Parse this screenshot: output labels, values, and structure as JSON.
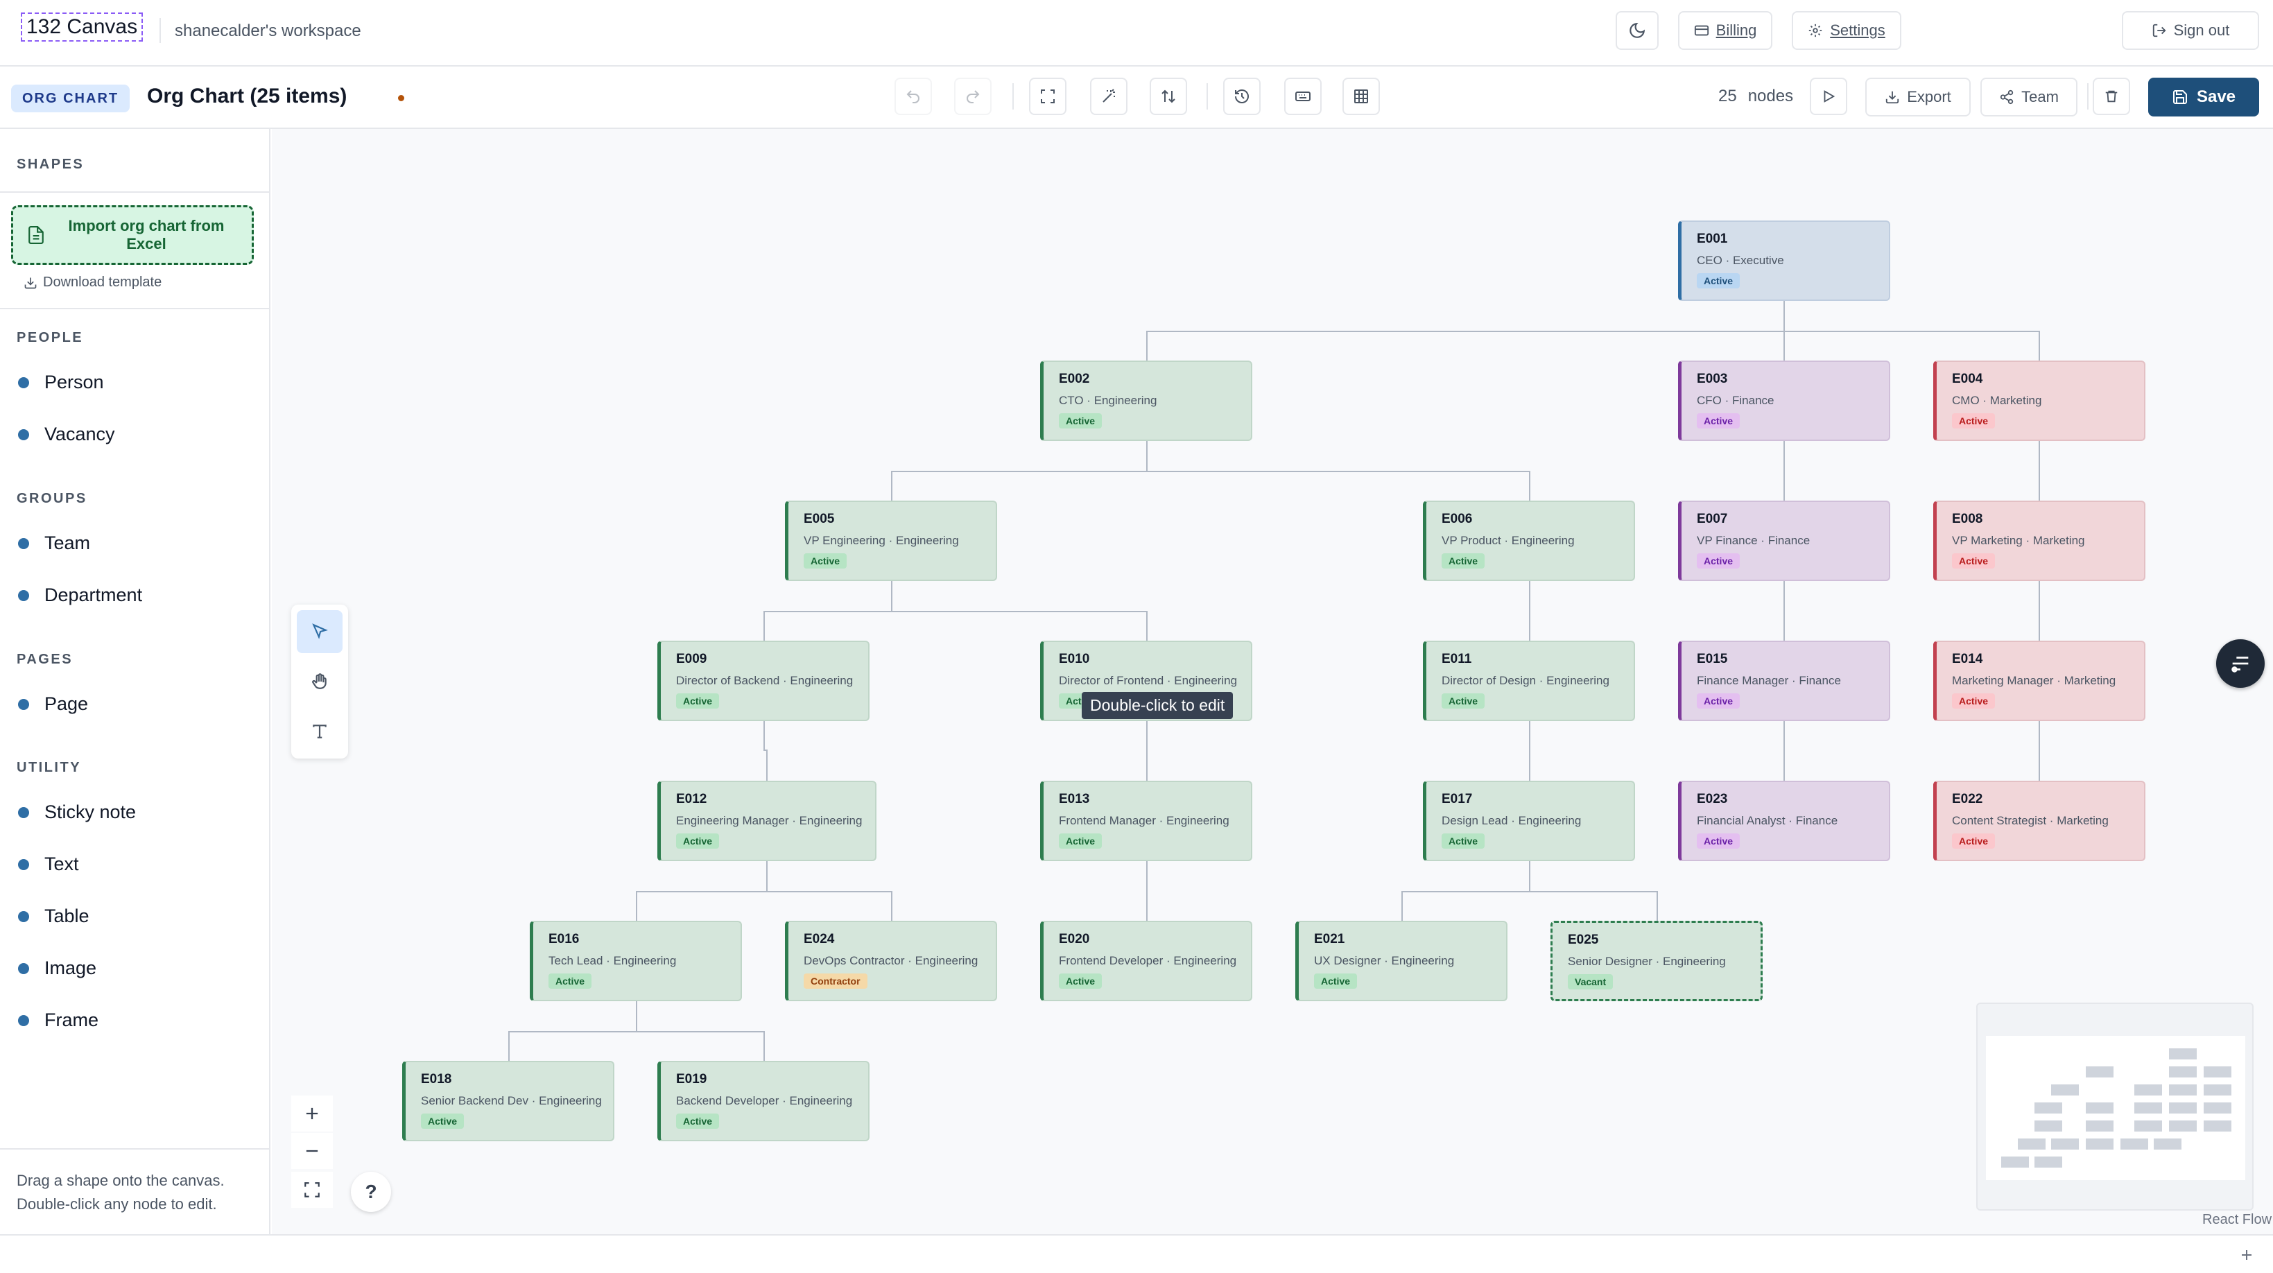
{
  "app": {
    "logo": "132 Canvas",
    "workspace": "shanecalder's workspace"
  },
  "topbar": {
    "billing": "Billing",
    "settings": "Settings",
    "sign_out": "Sign out"
  },
  "toolbar": {
    "doc_type_badge": "ORG CHART",
    "doc_title": "Org Chart (25 items)",
    "node_count": "25",
    "node_count_label": "nodes",
    "export": "Export",
    "team": "Team",
    "save": "Save"
  },
  "sidebar": {
    "shapes_heading": "SHAPES",
    "import_label": "Import org chart from Excel",
    "download_template": "Download template",
    "sections": [
      {
        "heading": "PEOPLE",
        "items": [
          "Person",
          "Vacancy"
        ]
      },
      {
        "heading": "GROUPS",
        "items": [
          "Team",
          "Department"
        ]
      },
      {
        "heading": "PAGES",
        "items": [
          "Page"
        ]
      },
      {
        "heading": "UTILITY",
        "items": [
          "Sticky note",
          "Text",
          "Table",
          "Image",
          "Frame"
        ]
      }
    ],
    "hint_line1": "Drag a shape onto the canvas.",
    "hint_line2": "Double-click any node to edit."
  },
  "nodes": [
    {
      "id": "E001",
      "role": "CEO",
      "dept": "Executive",
      "status": "Active",
      "color": "blue"
    },
    {
      "id": "E002",
      "role": "CTO",
      "dept": "Engineering",
      "status": "Active",
      "color": "green"
    },
    {
      "id": "E003",
      "role": "CFO",
      "dept": "Finance",
      "status": "Active",
      "color": "purple"
    },
    {
      "id": "E004",
      "role": "CMO",
      "dept": "Marketing",
      "status": "Active",
      "color": "red"
    },
    {
      "id": "E005",
      "role": "VP Engineering",
      "dept": "Engineering",
      "status": "Active",
      "color": "green"
    },
    {
      "id": "E006",
      "role": "VP Product",
      "dept": "Engineering",
      "status": "Active",
      "color": "green"
    },
    {
      "id": "E007",
      "role": "VP Finance",
      "dept": "Finance",
      "status": "Active",
      "color": "purple"
    },
    {
      "id": "E008",
      "role": "VP Marketing",
      "dept": "Marketing",
      "status": "Active",
      "color": "red"
    },
    {
      "id": "E009",
      "role": "Director of Backend",
      "dept": "Engineering",
      "status": "Active",
      "color": "green"
    },
    {
      "id": "E010",
      "role": "Director of Frontend",
      "dept": "Engineering",
      "status": "Active",
      "color": "green"
    },
    {
      "id": "E011",
      "role": "Director of Design",
      "dept": "Engineering",
      "status": "Active",
      "color": "green"
    },
    {
      "id": "E015",
      "role": "Finance Manager",
      "dept": "Finance",
      "status": "Active",
      "color": "purple"
    },
    {
      "id": "E014",
      "role": "Marketing Manager",
      "dept": "Marketing",
      "status": "Active",
      "color": "red"
    },
    {
      "id": "E012",
      "role": "Engineering Manager",
      "dept": "Engineering",
      "status": "Active",
      "color": "green"
    },
    {
      "id": "E013",
      "role": "Frontend Manager",
      "dept": "Engineering",
      "status": "Active",
      "color": "green"
    },
    {
      "id": "E017",
      "role": "Design Lead",
      "dept": "Engineering",
      "status": "Active",
      "color": "green"
    },
    {
      "id": "E023",
      "role": "Financial Analyst",
      "dept": "Finance",
      "status": "Active",
      "color": "purple"
    },
    {
      "id": "E022",
      "role": "Content Strategist",
      "dept": "Marketing",
      "status": "Active",
      "color": "red"
    },
    {
      "id": "E016",
      "role": "Tech Lead",
      "dept": "Engineering",
      "status": "Active",
      "color": "green"
    },
    {
      "id": "E024",
      "role": "DevOps Contractor",
      "dept": "Engineering",
      "status": "Contractor",
      "color": "green"
    },
    {
      "id": "E020",
      "role": "Frontend Developer",
      "dept": "Engineering",
      "status": "Active",
      "color": "green"
    },
    {
      "id": "E021",
      "role": "UX Designer",
      "dept": "Engineering",
      "status": "Active",
      "color": "green"
    },
    {
      "id": "E025",
      "role": "Senior Designer",
      "dept": "Engineering",
      "status": "Vacant",
      "color": "green"
    },
    {
      "id": "E018",
      "role": "Senior Backend Dev",
      "dept": "Engineering",
      "status": "Active",
      "color": "green"
    },
    {
      "id": "E019",
      "role": "Backend Developer",
      "dept": "Engineering",
      "status": "Active",
      "color": "green"
    }
  ],
  "canvas": {
    "tooltip": "Double-click to edit",
    "help": "?",
    "attribution": "React Flow"
  },
  "colors": {
    "accent": "#1e4f7a",
    "green": "#2e7d4f",
    "blue": "#2f6ea5",
    "purple": "#7e3a9b",
    "red": "#c2414f"
  }
}
